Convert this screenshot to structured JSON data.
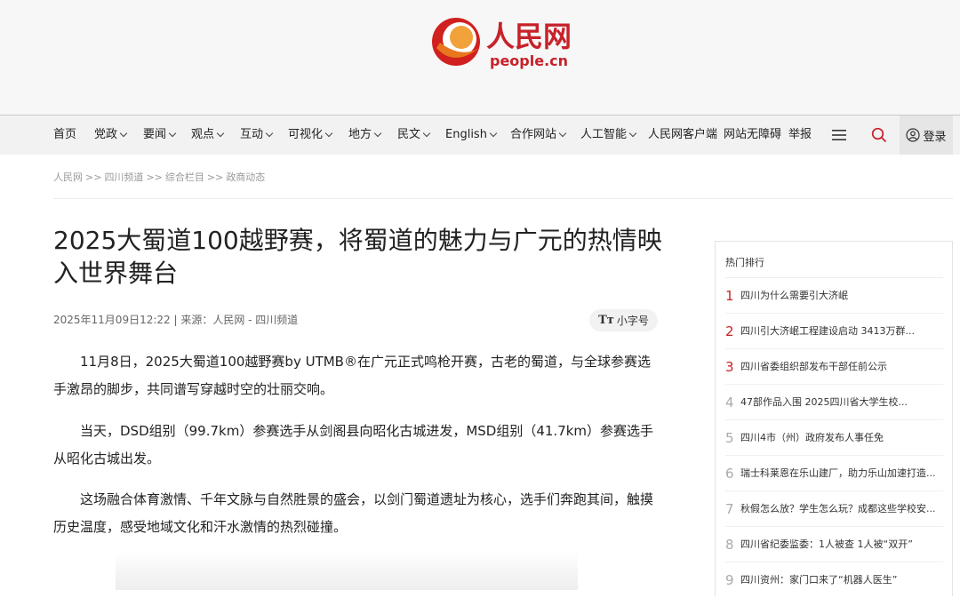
{
  "logo": {
    "text": "人民网",
    "domain": "people.cn",
    "accent": "#c7222a"
  },
  "nav": {
    "items": [
      {
        "label": "首页",
        "dropdown": false
      },
      {
        "label": "党政",
        "dropdown": true
      },
      {
        "label": "要闻",
        "dropdown": true
      },
      {
        "label": "观点",
        "dropdown": true
      },
      {
        "label": "互动",
        "dropdown": true
      },
      {
        "label": "可视化",
        "dropdown": true
      },
      {
        "label": "地方",
        "dropdown": true
      },
      {
        "label": "民文",
        "dropdown": true
      },
      {
        "label": "English",
        "dropdown": true
      },
      {
        "label": "合作网站",
        "dropdown": true
      },
      {
        "label": "人工智能",
        "dropdown": true
      },
      {
        "label": "人民网客户端",
        "dropdown": false
      },
      {
        "label": "网站无障碍",
        "dropdown": false
      },
      {
        "label": "举报",
        "dropdown": false
      }
    ],
    "menu_icon": "hamburger-icon",
    "search_icon": "search-icon",
    "login_label": "登录"
  },
  "breadcrumb": [
    "人民网",
    "四川频道",
    "综合栏目",
    "政商动态"
  ],
  "article": {
    "title": "2025大蜀道100越野赛，将蜀道的魅力与广元的热情映入世界舞台",
    "meta": "2025年11月09日12:22 | 来源：人民网 - 四川频道",
    "font_button": "小字号",
    "font_button_icon": "Tт",
    "paragraphs": [
      "11月8日，2025大蜀道100越野赛by UTMB®在广元正式鸣枪开赛，古老的蜀道，与全球参赛选手激昂的脚步，共同谱写穿越时空的壮丽交响。",
      "当天，DSD组别（99.7km）参赛选手从剑阁县向昭化古城进发，MSD组别（41.7km）参赛选手从昭化古城出发。",
      "这场融合体育激情、千年文脉与自然胜景的盛会，以剑门蜀道遗址为核心，选手们奔跑其间，触摸历史温度，感受地域文化和汗水激情的热烈碰撞。"
    ]
  },
  "sidebar": {
    "title": "热门排行",
    "items": [
      {
        "rank": "1",
        "text": "四川为什么需要引大济岷"
      },
      {
        "rank": "2",
        "text": "四川引大济岷工程建设启动 3413万群..."
      },
      {
        "rank": "3",
        "text": "四川省委组织部发布干部任前公示"
      },
      {
        "rank": "4",
        "text": "47部作品入围 2025四川省大学生校..."
      },
      {
        "rank": "5",
        "text": "四川4市（州）政府发布人事任免"
      },
      {
        "rank": "6",
        "text": "瑞士科莱恩在乐山建厂，助力乐山加速打造..."
      },
      {
        "rank": "7",
        "text": "秋假怎么放？学生怎么玩？成都这些学校安..."
      },
      {
        "rank": "8",
        "text": "四川省纪委监委：1人被查 1人被“双开”"
      },
      {
        "rank": "9",
        "text": "四川资州：家门口来了“机器人医生”"
      }
    ]
  }
}
